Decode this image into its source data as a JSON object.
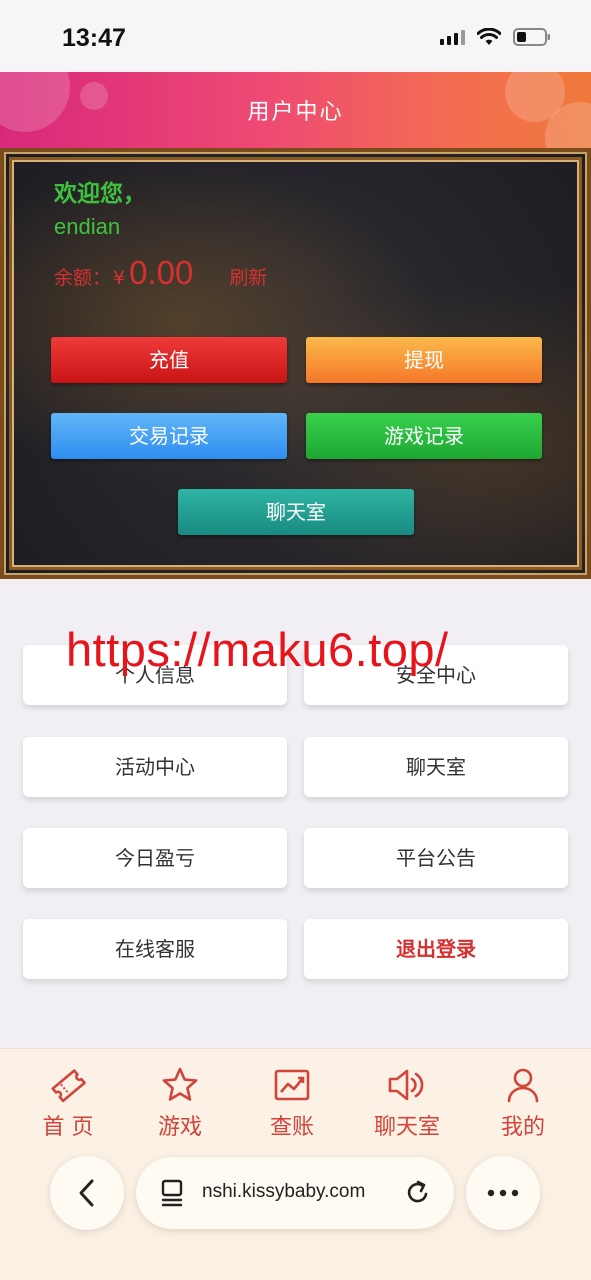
{
  "status_bar": {
    "time": "13:47"
  },
  "header": {
    "title": "用户中心"
  },
  "account": {
    "welcome": "欢迎您，",
    "username": "endian",
    "balance_label": "余额：",
    "currency": "¥",
    "balance": "0.00",
    "refresh": "刷新"
  },
  "actions": {
    "recharge": "充值",
    "withdraw": "提现",
    "trade_records": "交易记录",
    "game_records": "游戏记录",
    "chat_room": "聊天室"
  },
  "menu": {
    "personal_info": "个人信息",
    "security_center": "安全中心",
    "activity_center": "活动中心",
    "chat_room": "聊天室",
    "today_pnl": "今日盈亏",
    "announcements": "平台公告",
    "online_service": "在线客服",
    "logout": "退出登录"
  },
  "watermark": "https://maku6.top/",
  "bottom_nav": {
    "home": "首 页",
    "games": "游戏",
    "billing": "查账",
    "chat": "聊天室",
    "mine": "我的"
  },
  "browser": {
    "url": "nshi.kissybaby.com"
  },
  "colors": {
    "accent_red": "#d63030",
    "welcome_green": "#3ec23e",
    "header_gradient_start": "#d8287c",
    "header_gradient_end": "#f07a3c"
  }
}
